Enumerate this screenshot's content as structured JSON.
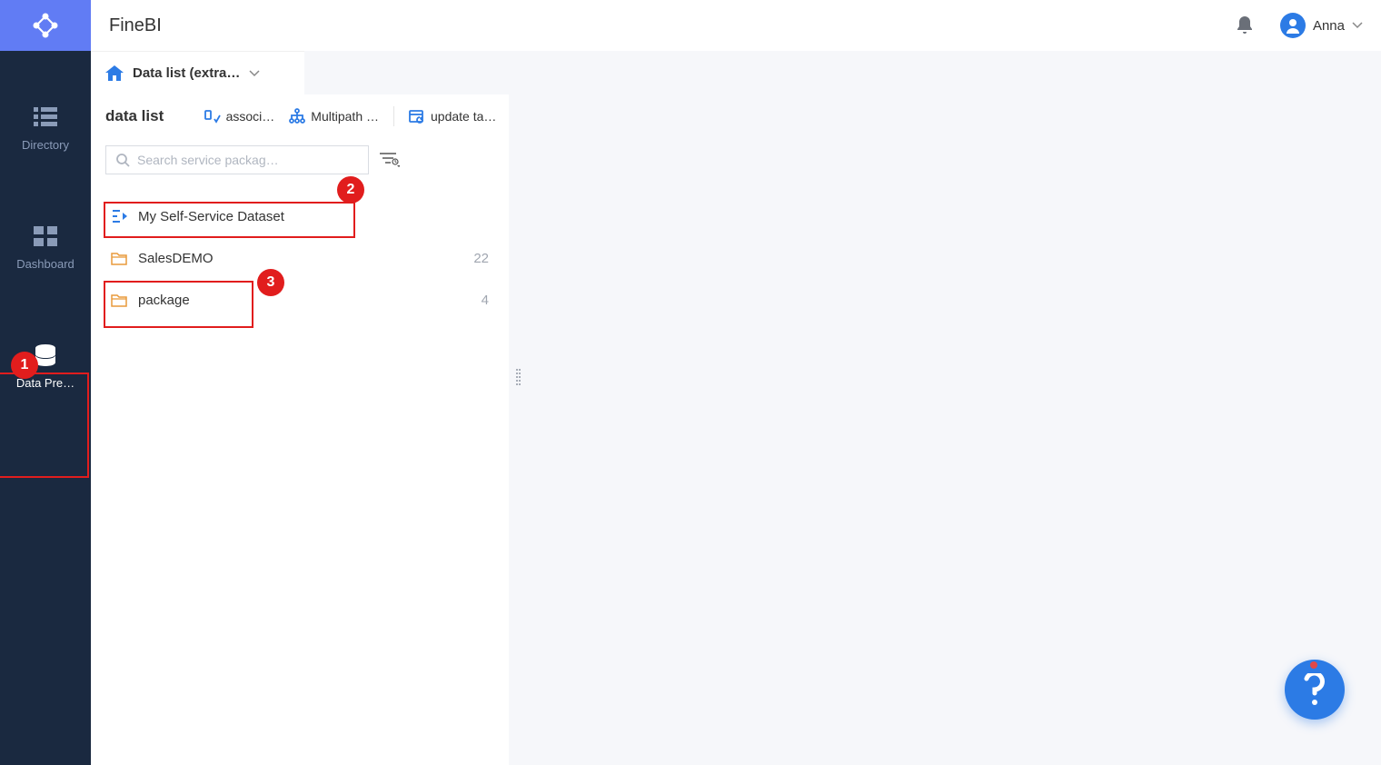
{
  "header": {
    "app_title": "FineBI",
    "user_name": "Anna"
  },
  "sidebar": {
    "items": [
      {
        "label": "Directory"
      },
      {
        "label": "Dashboard"
      },
      {
        "label": "Data Pre…"
      }
    ]
  },
  "breadcrumb": {
    "label": "Data list (extra…"
  },
  "panel": {
    "title": "data list",
    "actions": [
      {
        "label": "associ…"
      },
      {
        "label": "Multipath …"
      },
      {
        "label": "update task…"
      }
    ],
    "search_placeholder": "Search service packag…"
  },
  "datasets": [
    {
      "label": "My Self-Service Dataset",
      "count": ""
    },
    {
      "label": "SalesDEMO",
      "count": "22"
    },
    {
      "label": "package",
      "count": "4"
    }
  ],
  "annotations": {
    "badge1": "1",
    "badge2": "2",
    "badge3": "3"
  }
}
